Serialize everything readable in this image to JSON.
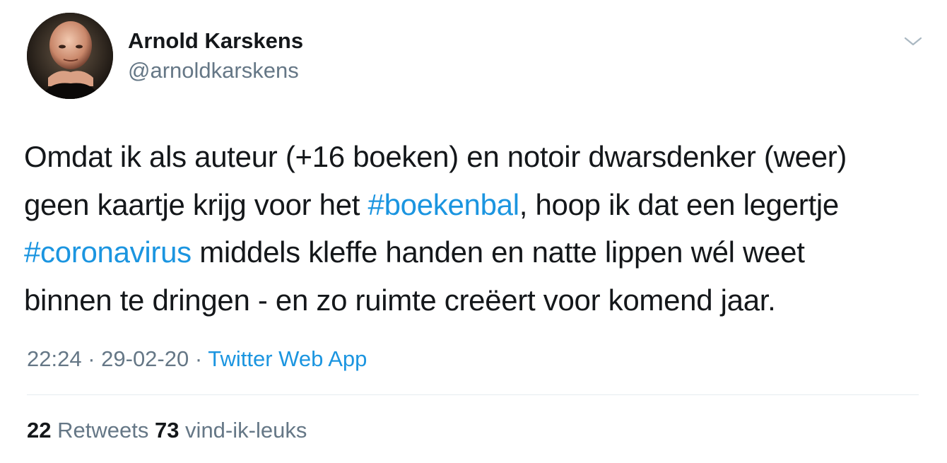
{
  "author": {
    "display_name": "Arnold Karskens",
    "handle": "@arnoldkarskens",
    "avatar_icon": "profile-photo"
  },
  "menu": {
    "caret_icon": "chevron-down-icon"
  },
  "tweet": {
    "line1": "Omdat ik als auteur (+16 boeken) en notoir dwarsdenker (weer)",
    "line2_a": "geen kaartje krijg voor het ",
    "hashtag1": "#boekenbal",
    "line2_b": ", hoop ik dat een legertje",
    "hashtag2": "#coronavirus",
    "line3_b": " middels kleffe handen en natte lippen wél weet",
    "line4": "binnen te dringen - en zo ruimte creëert voor komend jaar.",
    "hashtag_color": "#1b95e0"
  },
  "meta": {
    "time": "22:24",
    "sep1": " · ",
    "date": "29-02-20",
    "sep2": " · ",
    "source": "Twitter Web App"
  },
  "stats": {
    "retweets_count": "22",
    "retweets_label": " Retweets",
    "likes_count": "73",
    "likes_label": " vind-ik-leuks"
  }
}
